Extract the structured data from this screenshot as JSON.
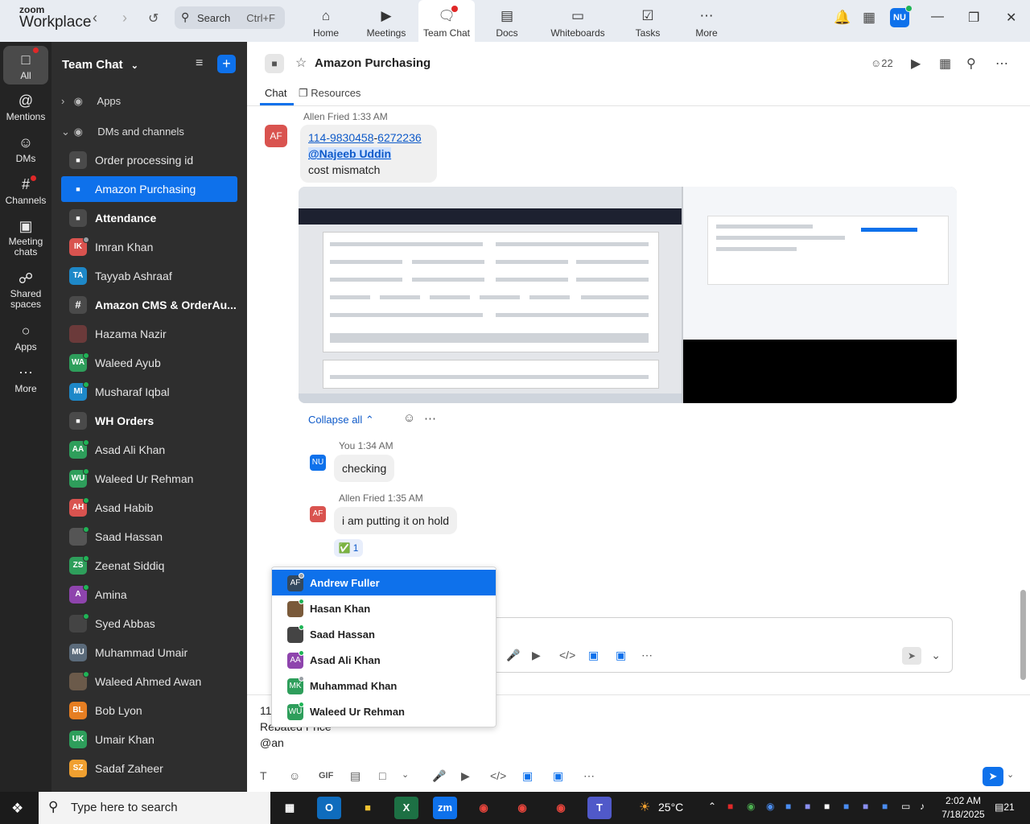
{
  "app": {
    "logo_line1": "zoom",
    "logo_line2": "Workplace",
    "search_label": "Search",
    "search_shortcut": "Ctrl+F"
  },
  "nav_tabs": [
    {
      "label": "Home",
      "icon": "home-icon"
    },
    {
      "label": "Meetings",
      "icon": "video-icon"
    },
    {
      "label": "Team Chat",
      "icon": "chat-icon"
    },
    {
      "label": "Docs",
      "icon": "docs-icon"
    },
    {
      "label": "Whiteboards",
      "icon": "whiteboard-icon"
    },
    {
      "label": "Tasks",
      "icon": "tasks-icon"
    },
    {
      "label": "More",
      "icon": "more-icon"
    }
  ],
  "user_initials": "NU",
  "rail": [
    {
      "label": "All",
      "icon": "chat-bubble-icon"
    },
    {
      "label": "Mentions",
      "icon": "at-icon"
    },
    {
      "label": "DMs",
      "icon": "people-icon"
    },
    {
      "label": "Channels",
      "icon": "hash-icon"
    },
    {
      "label": "Meeting chats",
      "icon": "calendar-icon"
    },
    {
      "label": "Shared spaces",
      "icon": "shared-icon"
    },
    {
      "label": "Apps",
      "icon": "apps-icon"
    },
    {
      "label": "More",
      "icon": "more-icon"
    }
  ],
  "sidebar": {
    "title": "Team Chat",
    "sections": {
      "apps": "Apps",
      "dms": "DMs and channels"
    },
    "items": [
      {
        "name": "Order processing id",
        "type": "lock",
        "bold": false
      },
      {
        "name": "Amazon Purchasing",
        "type": "lock",
        "bold": false,
        "active": true
      },
      {
        "name": "Attendance",
        "type": "lock",
        "bold": true
      },
      {
        "name": "Imran Khan",
        "initials": "IK",
        "color": "#d9534f",
        "status": "#9aa0a6"
      },
      {
        "name": "Tayyab Ashraaf",
        "initials": "TA",
        "color": "#1e88c8",
        "status": ""
      },
      {
        "name": "Amazon CMS & OrderAu...",
        "type": "hash",
        "bold": true
      },
      {
        "name": "Hazama Nazir",
        "initials": "",
        "color": "#6b3a3a",
        "status": ""
      },
      {
        "name": "Waleed Ayub",
        "initials": "WA",
        "color": "#2e9e5b",
        "status": "#1fb456"
      },
      {
        "name": "Musharaf Iqbal",
        "initials": "MI",
        "color": "#1e88c8",
        "status": "#1fb456"
      },
      {
        "name": "WH Orders",
        "type": "lock",
        "bold": true
      },
      {
        "name": "Asad Ali Khan",
        "initials": "AA",
        "color": "#2e9e5b",
        "status": "#1fb456"
      },
      {
        "name": "Waleed Ur Rehman",
        "initials": "WU",
        "color": "#2e9e5b",
        "status": "#1fb456"
      },
      {
        "name": "Asad Habib",
        "initials": "AH",
        "color": "#d9534f",
        "status": "#1fb456"
      },
      {
        "name": "Saad Hassan",
        "initials": "",
        "color": "#555555",
        "status": "#1fb456"
      },
      {
        "name": "Zeenat Siddiq",
        "initials": "ZS",
        "color": "#2e9e5b",
        "status": "#1fb456"
      },
      {
        "name": "Amina",
        "initials": "A",
        "color": "#8e44ad",
        "status": "#1fb456"
      },
      {
        "name": "Syed Abbas",
        "initials": "",
        "color": "#444444",
        "status": "#1fb456"
      },
      {
        "name": "Muhammad Umair",
        "initials": "MU",
        "color": "#5b6b7b",
        "status": ""
      },
      {
        "name": "Waleed Ahmed Awan",
        "initials": "",
        "color": "#6b5a4a",
        "status": "#1fb456"
      },
      {
        "name": "Bob Lyon",
        "initials": "BL",
        "color": "#e67e22",
        "status": ""
      },
      {
        "name": "Umair Khan",
        "initials": "UK",
        "color": "#2e9e5b",
        "status": ""
      },
      {
        "name": "Sadaf Zaheer",
        "initials": "SZ",
        "color": "#f0a030",
        "status": ""
      }
    ]
  },
  "channel": {
    "title": "Amazon Purchasing",
    "member_count": "22",
    "tabs": {
      "chat": "Chat",
      "resources": "Resources"
    }
  },
  "messages": {
    "m1": {
      "author": "Allen Fried",
      "time": "1:33 AM",
      "initials": "AF",
      "link_a": "114-9830458",
      "dash": "-",
      "link_b": "6272236",
      "mention": "@Najeeb Uddin",
      "text": "cost mismatch"
    },
    "collapse_label": "Collapse all",
    "replies": [
      {
        "author": "You",
        "time": "1:34 AM",
        "initials": "NU",
        "text": "checking"
      },
      {
        "author": "Allen Fried",
        "time": "1:35 AM",
        "initials": "AF",
        "text": "i am putting it on hold"
      }
    ],
    "reaction": {
      "emoji": "✅",
      "count": "1"
    }
  },
  "mention_dropdown": [
    {
      "name": "Andrew Fuller",
      "initials": "AF",
      "color": "#34495e",
      "status": "#9aa0a6",
      "selected": true
    },
    {
      "name": "Hasan Khan",
      "initials": "",
      "color": "#7a5a3a",
      "status": "#1fb456"
    },
    {
      "name": "Saad Hassan",
      "initials": "",
      "color": "#444444",
      "status": "#1fb456"
    },
    {
      "name": "Asad Ali Khan",
      "initials": "AA",
      "color": "#8e44ad",
      "status": "#1fb456"
    },
    {
      "name": "Muhammad Khan",
      "initials": "MK",
      "color": "#2e9e5b",
      "status": "#9aa0a6"
    },
    {
      "name": "Waleed Ur Rehman",
      "initials": "WU",
      "color": "#2e9e5b",
      "status": "#1fb456"
    }
  ],
  "composer": {
    "line1": "11",
    "line2": "Rebated Price",
    "line3": "@an"
  },
  "taskbar": {
    "search_placeholder": "Type here to search",
    "weather": "25°C",
    "time": "2:02 AM",
    "date": "7/18/2025",
    "notifications": "21"
  }
}
